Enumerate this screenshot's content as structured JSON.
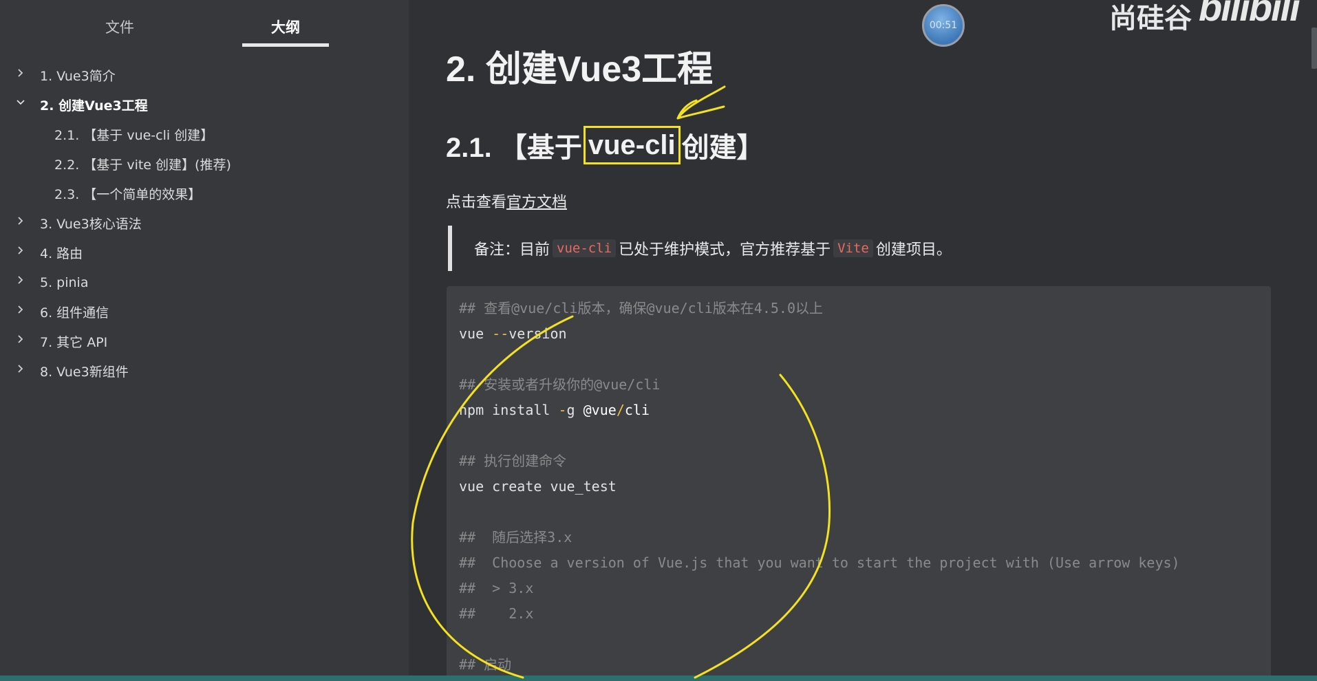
{
  "tabs": {
    "files": "文件",
    "outline": "大纲"
  },
  "outline": [
    {
      "label": "1. Vue3简介",
      "level": 1,
      "expanded": false,
      "active": false
    },
    {
      "label": "2. 创建Vue3工程",
      "level": 1,
      "expanded": true,
      "active": true
    },
    {
      "label": "2.1. 【基于 vue-cli 创建】",
      "level": 2
    },
    {
      "label": "2.2. 【基于 vite 创建】(推荐)",
      "level": 2
    },
    {
      "label": "2.3. 【一个简单的效果】",
      "level": 2
    },
    {
      "label": "3. Vue3核心语法",
      "level": 1,
      "expanded": false
    },
    {
      "label": "4. 路由",
      "level": 1,
      "expanded": false
    },
    {
      "label": "5. pinia",
      "level": 1,
      "expanded": false
    },
    {
      "label": "6. 组件通信",
      "level": 1,
      "expanded": false
    },
    {
      "label": "7. 其它 API",
      "level": 1,
      "expanded": false
    },
    {
      "label": "8. Vue3新组件",
      "level": 1,
      "expanded": false
    }
  ],
  "main": {
    "title": "2. 创建Vue3工程",
    "section": {
      "prefix": "2.1. 【基于",
      "highlight": "vue-cli",
      "suffix": "创建】"
    },
    "doc_text": "点击查看",
    "doc_link": "官方文档",
    "note": {
      "prefix": "备注：目前",
      "code1": "vue-cli",
      "middle": "已处于维护模式，官方推荐基于",
      "code2": "Vite",
      "suffix": "创建项目。"
    },
    "code": {
      "l1": "## 查看@vue/cli版本，确保@vue/cli版本在4.5.0以上",
      "l2a": "vue ",
      "l2b": "--",
      "l2c": "version",
      "l4": "## 安装或者升级你的@vue/cli",
      "l5a": "npm install ",
      "l5b": "-",
      "l5c": "g ",
      "l5d": "@vue",
      "l5e": "/",
      "l5f": "cli",
      "l7": "## 执行创建命令",
      "l8": "vue create vue_test",
      "l10": "##  随后选择3.x",
      "l11": "##  Choose a version of Vue.js that you want to start the project with (Use arrow keys)",
      "l12": "##  > 3.x",
      "l13": "##    2.x",
      "l15": "## 启动"
    }
  },
  "overlay": {
    "timer": "00:51",
    "brand_cn": "尚硅谷",
    "brand_bili": "bilibili"
  },
  "colors": {
    "annotation": "#f4e21e",
    "inline_code": "#e96a5e",
    "bottom_strip": "#2b6f6e"
  }
}
